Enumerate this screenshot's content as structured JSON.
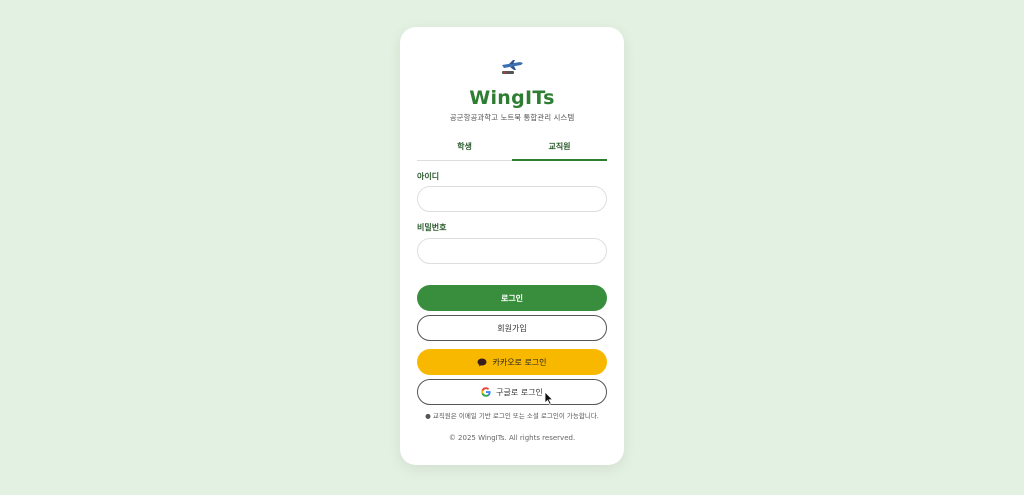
{
  "brand": {
    "name": "WingITs",
    "subtitle": "공군항공과학고 노트북 통합관리 시스템"
  },
  "tabs": [
    {
      "label": "학생",
      "active": false
    },
    {
      "label": "교직원",
      "active": true
    }
  ],
  "form": {
    "id_label": "아이디",
    "id_value": "",
    "password_label": "비밀번호",
    "password_value": ""
  },
  "buttons": {
    "login": "로그인",
    "signup": "회원가입",
    "kakao": "카카오로 로그인",
    "google": "구글로 로그인"
  },
  "note": "● 교직원은 이메일 기반 로그인 또는 소셜 로그인이 가능합니다.",
  "footer": "© 2025 WingITs. All rights reserved.",
  "colors": {
    "background": "#e3f1e2",
    "primary": "#388e3c",
    "brand_text": "#2e7d32",
    "kakao": "#f9b800"
  },
  "icons": [
    "airplane-icon",
    "kakao-chat-icon",
    "google-icon",
    "mouse-cursor-icon"
  ]
}
